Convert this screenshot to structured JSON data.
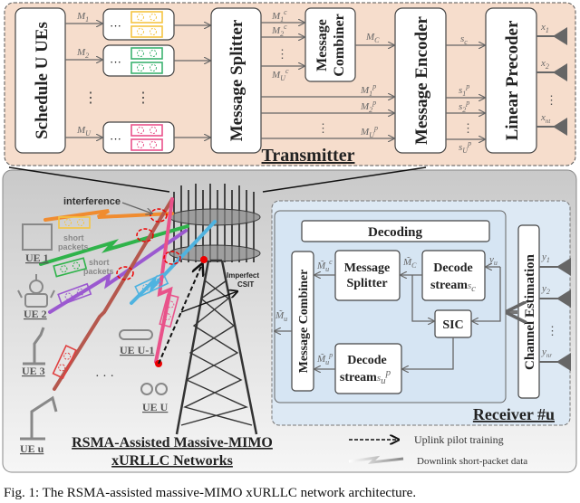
{
  "colors": {
    "transmitter_bg": "#f6ddcc",
    "network_bg": "#d9d9d9",
    "receiver_bg": "#dde9f4",
    "packet_yellow": "#f5c542",
    "packet_green": "#3cb371",
    "packet_pink": "#e9528a",
    "packet_purple": "#9b59d0",
    "packet_blue": "#4fb3e0",
    "packet_red": "#e04040",
    "csit_point": "#e00000"
  },
  "transmitter": {
    "title": "Transmitter",
    "schedule": "Schedule U UEs",
    "splitter": "Message Splitter",
    "combiner_1": "Message",
    "combiner_2": "Combiner",
    "encoder": "Message Encoder",
    "precoder": "Linear Precoder",
    "inputs": [
      {
        "b": "M",
        "s": "1"
      },
      {
        "b": "M",
        "s": "2"
      },
      {
        "b": "M",
        "s": "U"
      }
    ],
    "common_parts": [
      {
        "b": "M",
        "s": "1",
        "p": "c"
      },
      {
        "b": "M",
        "s": "2",
        "p": "c"
      },
      {
        "b": "M",
        "s": "U",
        "p": "c"
      }
    ],
    "combined": {
      "b": "M",
      "s": "C"
    },
    "private_parts": [
      {
        "b": "M",
        "s": "1",
        "p": "p"
      },
      {
        "b": "M",
        "s": "2",
        "p": "p"
      },
      {
        "b": "M",
        "s": "U",
        "p": "p"
      }
    ],
    "common_stream": {
      "b": "s",
      "s": "c"
    },
    "private_streams": [
      {
        "b": "s",
        "s": "1",
        "p": "p"
      },
      {
        "b": "s",
        "s": "2",
        "p": "p"
      },
      {
        "b": "s",
        "s": "U",
        "p": "p"
      }
    ],
    "outputs": [
      {
        "b": "x",
        "s": "1"
      },
      {
        "b": "x",
        "s": "2"
      },
      {
        "b": "x",
        "s": "nt"
      }
    ],
    "dots": "⋮",
    "hdots": "···"
  },
  "network": {
    "title_1": "RSMA-Assisted Massive-MIMO",
    "title_2": "xURLLC Networks",
    "interference": "interference",
    "short_1": "short",
    "packets_1": "packets",
    "short_2": "short",
    "packets_2": "packets",
    "imperfect_1": "Imperfect",
    "imperfect_2": "CSIT",
    "ues": [
      "UE 1",
      "UE 2",
      "UE 3",
      "UE U-1",
      "UE U",
      "UE u"
    ],
    "ellipsis": "· · ·"
  },
  "receiver": {
    "title": "Receiver #u",
    "decoding": "Decoding",
    "combiner": "Message Combiner",
    "splitter_1": "Message",
    "splitter_2": "Splitter",
    "decode_c_1": "Decode",
    "decode_c_2": "stream",
    "decode_c_var": {
      "b": "s",
      "s": "c"
    },
    "sic": "SIC",
    "decode_p_1": "Decode",
    "decode_p_2": "stream",
    "decode_p_var": {
      "b": "s",
      "s": "u",
      "p": "p"
    },
    "channel_est": "Channel Estimation",
    "yu": {
      "b": "y",
      "s": "u"
    },
    "Mc_tilde": {
      "b": "M̃",
      "s": "C"
    },
    "Muc_tilde": {
      "b": "M̃",
      "s": "u",
      "p": "c"
    },
    "Mup_tilde": {
      "b": "M̃",
      "s": "u",
      "p": "p"
    },
    "Mu_tilde": {
      "b": "M̃",
      "s": "u"
    },
    "antennas": [
      {
        "b": "y",
        "s": "1"
      },
      {
        "b": "y",
        "s": "2"
      },
      {
        "b": "y",
        "s": "nr"
      }
    ],
    "dots": "⋮"
  },
  "legend": {
    "uplink": "Uplink pilot training",
    "downlink": "Downlink short-packet data"
  },
  "caption": "Fig. 1: The RSMA-assisted massive-MIMO xURLLC network architecture."
}
